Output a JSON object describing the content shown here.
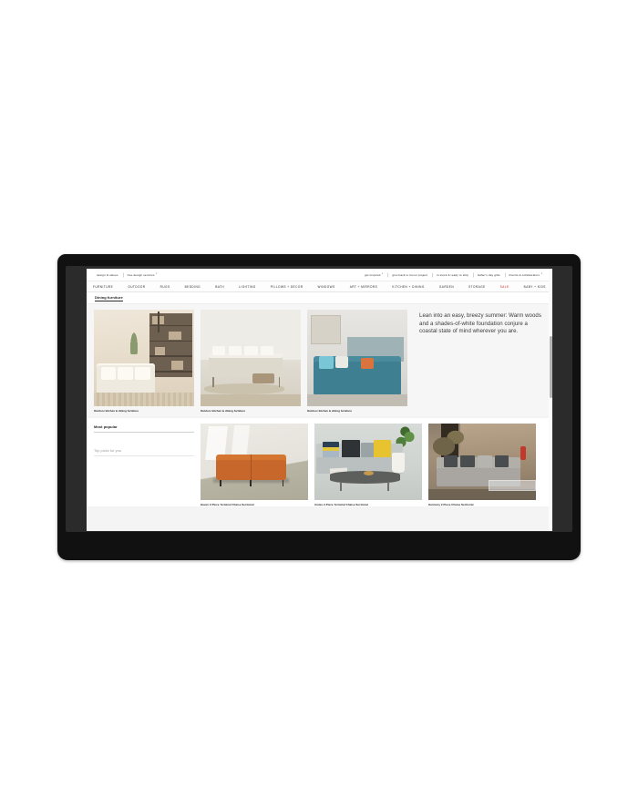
{
  "device": {
    "type": "flat-panel-display",
    "bezel_color": "#111111",
    "screen_bg": "#f4f4f4"
  },
  "site": {
    "utility_nav_left": [
      {
        "label": "design & values",
        "caret": false
      },
      {
        "label": "free design services",
        "caret": true
      }
    ],
    "utility_nav_right": [
      {
        "label": "get inspired",
        "caret": true
      },
      {
        "label": "give back to trevor project",
        "caret": false
      },
      {
        "label": "in stock & ready to ship",
        "caret": false
      },
      {
        "label": "father's day gifts",
        "caret": false
      },
      {
        "label": "friends & collaborators",
        "caret": true
      }
    ],
    "category_nav": [
      {
        "label": "FURNITURE",
        "sale": false
      },
      {
        "label": "OUTDOOR",
        "sale": false
      },
      {
        "label": "RUGS",
        "sale": false
      },
      {
        "label": "BEDDING",
        "sale": false
      },
      {
        "label": "BATH",
        "sale": false
      },
      {
        "label": "LIGHTING",
        "sale": false
      },
      {
        "label": "PILLOWS + DECOR",
        "sale": false
      },
      {
        "label": "WINDOWS",
        "sale": false
      },
      {
        "label": "ART + MIRRORS",
        "sale": false
      },
      {
        "label": "KITCHEN + DINING",
        "sale": false
      },
      {
        "label": "GARDEN",
        "sale": false
      },
      {
        "label": "STORAGE",
        "sale": false
      },
      {
        "label": "SALE",
        "sale": true
      },
      {
        "label": "BABY + KIDS",
        "sale": false
      }
    ],
    "sale_color": "#d0232b",
    "breadcrumb": "Dining furniture",
    "hero": {
      "cards": [
        {
          "caption": "Outdoor kitchen & dining furniture"
        },
        {
          "caption": "Outdoor kitchen & dining furniture"
        },
        {
          "caption": "Outdoor kitchen & dining furniture"
        }
      ],
      "editorial_text": "Lean into an easy, breezy summer: Warm woods and a shades-of-white foundation conjure a coastal state of mind wherever you are."
    },
    "sidebar": {
      "heading": "Most popular",
      "subheading": "Top picks for you"
    },
    "products": [
      {
        "name": "Haven 2-Piece Terminal Chaise Sectional"
      },
      {
        "name": "Andes 2-Piece Terminal Chaise Sectional"
      },
      {
        "name": "Harmony 2-Piece Chaise Sectional"
      }
    ]
  }
}
